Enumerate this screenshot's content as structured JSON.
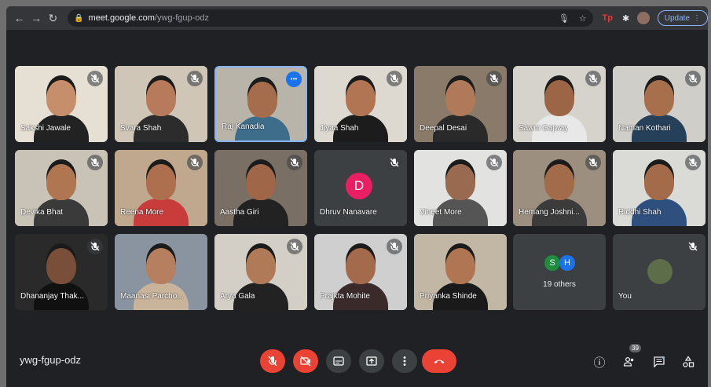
{
  "browser": {
    "url_host": "meet.google.com",
    "url_path": "/ywg-fgup-odz",
    "update_label": "Update"
  },
  "participants": [
    {
      "name": "Sakshi Jawale",
      "muted": true,
      "bg": "#4a4a4a",
      "photo": "#e6e0d4",
      "skin": "#c68e6a",
      "cloth": "#222222"
    },
    {
      "name": "Svara Shah",
      "muted": true,
      "bg": "#cfc6b8",
      "photo": "#cfc6b8",
      "skin": "#b77a5a",
      "cloth": "#2c2c2c"
    },
    {
      "name": "Raj Kanadia",
      "muted": false,
      "active": true,
      "bg": "#b8b4aa",
      "photo": "#b8b4aa",
      "skin": "#a56d4b",
      "cloth": "#3e6d8c"
    },
    {
      "name": "Jiyaa Shah",
      "muted": true,
      "bg": "#ddd8d0",
      "photo": "#ddd8d0",
      "skin": "#b27553",
      "cloth": "#1c1c1c"
    },
    {
      "name": "Deepal Desai",
      "muted": true,
      "bg": "#8a7a6a",
      "photo": "#8a7a6a",
      "skin": "#b07a5a",
      "cloth": "#2a2a2a"
    },
    {
      "name": "Sawni Gajway",
      "muted": true,
      "bg": "#d6d2cc",
      "photo": "#d6d2cc",
      "skin": "#9b6546",
      "cloth": "#e8e8e8"
    },
    {
      "name": "Naman Kothari",
      "muted": true,
      "bg": "#d0cec8",
      "photo": "#d0cec8",
      "skin": "#a86f4c",
      "cloth": "#26405a"
    },
    {
      "name": "Devika Bhat",
      "muted": true,
      "bg": "#c9c2b6",
      "photo": "#c9c2b6",
      "skin": "#b07652",
      "cloth": "#3a3a3a"
    },
    {
      "name": "Reena More",
      "muted": true,
      "bg": "#bfa88e",
      "photo": "#bfa88e",
      "skin": "#ad6f4e",
      "cloth": "#c83c3c"
    },
    {
      "name": "Aastha Giri",
      "muted": true,
      "bg": "#7a6f64",
      "photo": "#7a6f64",
      "skin": "#9f6647",
      "cloth": "#222222"
    },
    {
      "name": "Dhruv Nanavare",
      "muted": true,
      "initial": "D",
      "bg": "#3c4043"
    },
    {
      "name": "Vineet More",
      "muted": true,
      "bg": "#e2e2e0",
      "photo": "#e2e2e0",
      "skin": "#9a6a50",
      "cloth": "#555555"
    },
    {
      "name": "Hemang Joshni...",
      "muted": true,
      "bg": "#9c8f80",
      "photo": "#9c8f80",
      "skin": "#a26b4a",
      "cloth": "#3b3b3b"
    },
    {
      "name": "Riddhi Shah",
      "muted": true,
      "bg": "#dadad6",
      "photo": "#dadad6",
      "skin": "#a46b4a",
      "cloth": "#2f4f7f"
    },
    {
      "name": "Dhananjay Thak...",
      "muted": true,
      "bg": "#2a2a2a",
      "photo": "#2a2a2a",
      "skin": "#7a4f39",
      "cloth": "#111111"
    },
    {
      "name": "Maanasi Parcho...",
      "muted": false,
      "bg": "#8a93a0",
      "photo": "#8a93a0",
      "skin": "#b68060",
      "cloth": "#c9b39a"
    },
    {
      "name": "Arya Gala",
      "muted": true,
      "bg": "#d4cfc6",
      "photo": "#d4cfc6",
      "skin": "#b07a58",
      "cloth": "#222222"
    },
    {
      "name": "Prajkta Mohite",
      "muted": true,
      "bg": "#cfcfcf",
      "photo": "#cfcfcf",
      "skin": "#a36b4b",
      "cloth": "#3a2a2a"
    },
    {
      "name": "Priyanka Shinde",
      "muted": false,
      "bg": "#c2b6a4",
      "photo": "#c2b6a4",
      "skin": "#b07552",
      "cloth": "#1a1a1a"
    }
  ],
  "others_tile": {
    "label": "19 others",
    "avatars": [
      {
        "letter": "S",
        "color": "#1e8e3e"
      },
      {
        "letter": "H",
        "color": "#1a73e8"
      }
    ]
  },
  "you_tile": {
    "label": "You",
    "muted": true
  },
  "meeting_code": "ywg-fgup-odz",
  "participant_count": "39",
  "colors": {
    "red_button": "#ea4335",
    "grey_button": "#3c4043",
    "accent": "#8ab4f8"
  }
}
